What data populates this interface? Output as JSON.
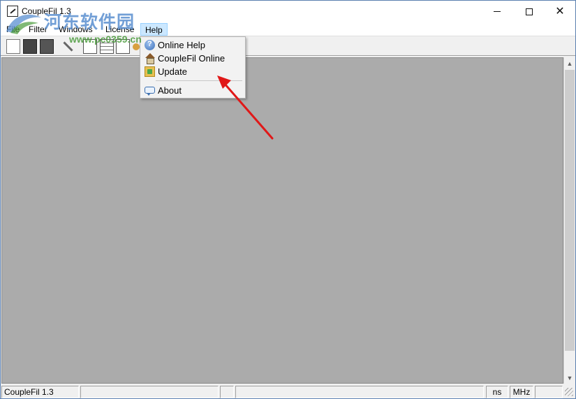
{
  "window": {
    "title": "CoupleFil 1.3",
    "controls": {
      "minimize": "",
      "maximize": "",
      "close": "✕"
    }
  },
  "watermark": {
    "text": "河东软件园",
    "url": "www.pc0359.cn"
  },
  "menubar": {
    "items": [
      "File",
      "Filter",
      "Windows",
      "License",
      "Help"
    ],
    "active": "Help"
  },
  "toolbar": {
    "buttons": [
      "new-icon",
      "open-icon",
      "save-icon",
      "tool-icon",
      "chart-icon",
      "grid-icon",
      "tree-icon",
      "user-icon"
    ]
  },
  "help_menu": {
    "items": [
      {
        "label": "Online Help",
        "icon": "help-icon"
      },
      {
        "label": "CoupleFil Online",
        "icon": "home-icon"
      },
      {
        "label": "Update",
        "icon": "update-icon"
      },
      {
        "label": "About",
        "icon": "speech-bubble-icon"
      }
    ]
  },
  "statusbar": {
    "app": "CoupleFil 1.3",
    "panel2": "",
    "panel3": "",
    "panel4": "",
    "time_unit": "ns",
    "freq_unit": "MHz",
    "panel7": ""
  },
  "colors": {
    "client_background": "#ababab",
    "menu_highlight": "#cce8ff",
    "annotation_arrow": "#e01818"
  }
}
